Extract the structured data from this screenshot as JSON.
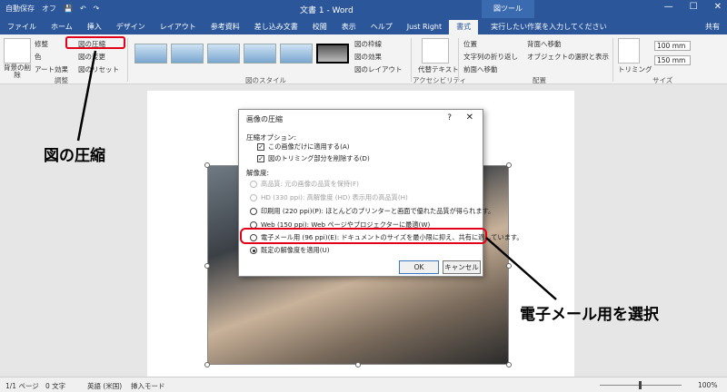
{
  "titlebar": {
    "autosave": "自動保存",
    "autosave_state": "オフ",
    "doc_title": "文書 1 - Word",
    "context_tab": "図ツール",
    "min": "—",
    "max": "☐",
    "close": "✕"
  },
  "tabs": [
    "ファイル",
    "ホーム",
    "挿入",
    "デザイン",
    "レイアウト",
    "参考資料",
    "差し込み文書",
    "校閲",
    "表示",
    "ヘルプ",
    "Just Right",
    "書式"
  ],
  "tellme": "実行したい作業を入力してください",
  "share": "共有",
  "ribbon": {
    "remove_bg": "背景の削除",
    "corrections": "修整",
    "color": "色",
    "artistic": "アート効果",
    "compress": "図の圧縮",
    "change": "図の変更",
    "reset": "図のリセット",
    "group_adjust": "調整",
    "border": "図の枠線",
    "effects": "図の効果",
    "layout": "図のレイアウト",
    "group_styles": "図のスタイル",
    "alt_text": "代替テキスト",
    "group_access": "アクセシビリティ",
    "position": "位置",
    "wrap": "文字列の折り返し",
    "forward": "前面へ移動",
    "backward": "背面へ移動",
    "selection": "オブジェクトの選択と表示",
    "group_arrange": "配置",
    "crop": "トリミング",
    "height": "100 mm",
    "width": "150 mm",
    "group_size": "サイズ"
  },
  "dialog": {
    "title": "画像の圧縮",
    "help": "?",
    "close": "✕",
    "compress_options": "圧縮オプション:",
    "apply_only": "この画像だけに適用する(A)",
    "delete_cropped": "図のトリミング部分を削除する(D)",
    "resolution": "解像度:",
    "options": [
      {
        "label": "高品質: 元の画像の品質を保持(F)",
        "disabled": true,
        "checked": false
      },
      {
        "label": "HD (330 ppi): 高解像度 (HD) 表示用の高品質(H)",
        "disabled": true,
        "checked": false
      },
      {
        "label": "印刷用 (220 ppi)(P): ほとんどのプリンターと画面で優れた品質が得られます。",
        "disabled": false,
        "checked": false
      },
      {
        "label": "Web (150 ppi): Web ページやプロジェクターに最適(W)",
        "disabled": false,
        "checked": false
      },
      {
        "label": "電子メール用 (96 ppi)(E): ドキュメントのサイズを最小限に抑え、共有に適しています。",
        "disabled": false,
        "checked": false
      },
      {
        "label": "既定の解像度を適用(U)",
        "disabled": false,
        "checked": true
      }
    ],
    "ok": "OK",
    "cancel": "キャンセル"
  },
  "annotations": {
    "compress": "図の圧縮",
    "email": "電子メール用を選択"
  },
  "status": {
    "page": "1/1 ページ",
    "words": "0 文字",
    "lang": "英語 (米国)",
    "mode": "挿入モード",
    "zoom": "100%"
  }
}
